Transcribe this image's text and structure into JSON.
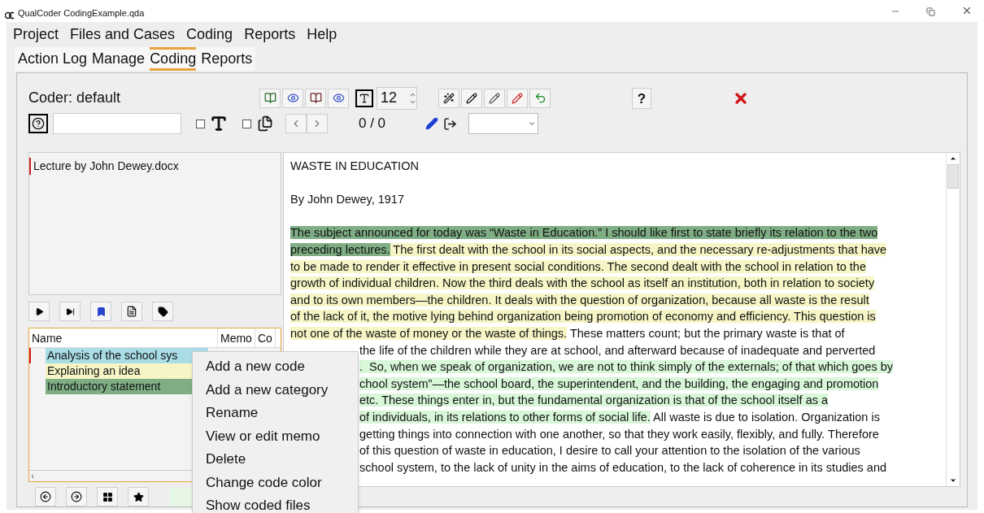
{
  "window": {
    "title": "QualCoder CodingExample.qda"
  },
  "menu_bar": [
    "Project",
    "Files and Cases",
    "Coding",
    "Reports",
    "Help"
  ],
  "tabs": [
    {
      "label": "Action Log",
      "selected": false
    },
    {
      "label": "Manage",
      "selected": false
    },
    {
      "label": "Coding",
      "selected": true
    },
    {
      "label": "Reports",
      "selected": false
    }
  ],
  "toolbar": {
    "coder": "Coder: default",
    "font_size": "12",
    "help": "?",
    "counter": "0 / 0",
    "checkboxes": [
      {
        "checked": false
      },
      {
        "checked": false
      }
    ]
  },
  "files": [
    {
      "name": "Lecture by John Dewey.docx",
      "selected": true
    }
  ],
  "code_tree": {
    "columns": [
      "Name",
      "Memo",
      "Co"
    ],
    "items": [
      {
        "name": "Analysis of the school sys",
        "color": "#a9dde6",
        "selected": true
      },
      {
        "name": "Explaining an idea",
        "color": "#f6f5c6",
        "selected": false
      },
      {
        "name": "Introductory statement",
        "color": "#7fae84",
        "selected": false
      }
    ]
  },
  "context_menu": [
    "Add a new code",
    "Add a new category",
    "Rename",
    "View or edit memo",
    "Delete",
    "Change code color",
    "Show coded files"
  ],
  "document": {
    "lines": [
      {
        "kind": "full",
        "segments": [
          {
            "text": "WASTE IN EDUCATION"
          }
        ]
      },
      {
        "kind": "blank"
      },
      {
        "kind": "full",
        "segments": [
          {
            "text": "By John Dewey, 1917"
          }
        ]
      },
      {
        "kind": "blank"
      },
      {
        "kind": "full",
        "segments": [
          {
            "text": "The subject announced for today was “Waste in Education.” I should like first to state briefly its relation to the two",
            "color": "#7fae84"
          }
        ]
      },
      {
        "kind": "full",
        "segments": [
          {
            "text": "preceding lectures.",
            "color": "#7fae84"
          },
          {
            "text": " The first dealt with the school in its social aspects, and the necessary re-adjustments that have",
            "color": "#f6f5c6"
          }
        ]
      },
      {
        "kind": "full",
        "segments": [
          {
            "text": "to be made to render it effective in present social conditions. The second dealt with the school in relation to the",
            "color": "#f6f5c6"
          }
        ]
      },
      {
        "kind": "full",
        "segments": [
          {
            "text": "growth of individual children. Now the third deals with the school as itself an institution, both in relation to society",
            "color": "#f6f5c6"
          }
        ]
      },
      {
        "kind": "full",
        "segments": [
          {
            "text": "and to its own members—the children. It deals with the question of organization, because all waste is the result",
            "color": "#f6f5c6"
          }
        ]
      },
      {
        "kind": "full",
        "segments": [
          {
            "text": "of the lack of it, the motive lying behind organization being promotion of economy and efficiency. This question is",
            "color": "#f6f5c6"
          }
        ]
      },
      {
        "kind": "full",
        "segments": [
          {
            "text": "not one of the waste of money or the waste of things.",
            "color": "#f6f5c6"
          },
          {
            "text": " These matters count; but the primary waste is that of"
          }
        ]
      },
      {
        "kind": "partial",
        "segments": [
          {
            "text": "the life of the children while they are at school, and afterward because of inadequate and perverted"
          }
        ]
      },
      {
        "kind": "partial",
        "segments": [
          {
            "text": ".  So, when we speak of organization, we are not to think simply of the externals; of that which goes by",
            "color": "#d8f6d8"
          }
        ]
      },
      {
        "kind": "partial",
        "segments": [
          {
            "text": "chool system”—the school board, the superintendent, and the building, the engaging and promotion",
            "color": "#d8f6d8"
          }
        ]
      },
      {
        "kind": "partial",
        "segments": [
          {
            "text": "etc. These things enter in, but the fundamental organization is that of the school itself as a",
            "color": "#d8f6d8"
          }
        ]
      },
      {
        "kind": "partial",
        "segments": [
          {
            "text": "of individuals, in its relations to other forms of social life.",
            "color": "#d8f6d8"
          },
          {
            "text": " All waste is due to isolation. Organization is"
          }
        ]
      },
      {
        "kind": "partial",
        "segments": [
          {
            "text": "getting things into connection with one another, so that they work easily, flexibly, and fully. Therefore"
          }
        ]
      },
      {
        "kind": "partial",
        "segments": [
          {
            "text": "of this question of waste in education, I desire to call your attention to the isolation of the various"
          }
        ]
      },
      {
        "kind": "partial",
        "segments": [
          {
            "text": "school system, to the lack of unity in the aims of education, to the lack of coherence in its studies and"
          }
        ]
      }
    ]
  }
}
